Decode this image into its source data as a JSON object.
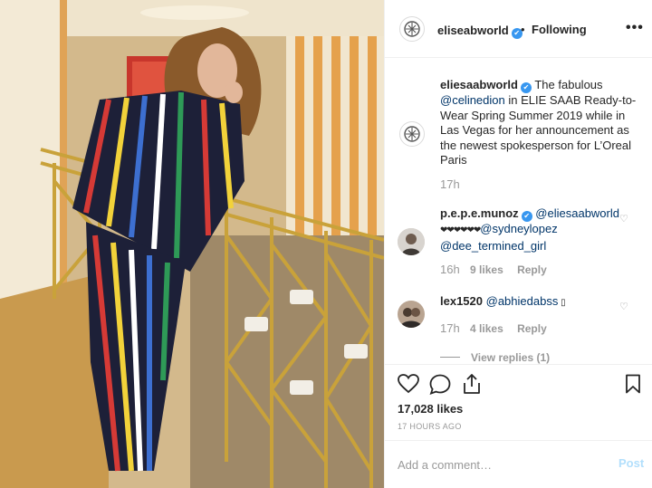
{
  "photo": {
    "description_icon": "fashion-photo"
  },
  "header": {
    "username": "eliseabworld",
    "separator": "•",
    "follow_status": "Following",
    "more_label": "•••"
  },
  "caption": {
    "username": "eliesaabworld",
    "text_1": " The fabulous ",
    "mention": "@celinedion",
    "text_2": " in ELIE SAAB Ready-to-Wear Spring Summer 2019 while in Las Vegas for her announcement as the newest spokesperson for L’Oreal Paris",
    "time": "17h"
  },
  "comments": [
    {
      "username": "p.e.p.e.munoz",
      "mention_1": "@eliesaabworld",
      "hearts": "❤❤❤❤❤❤",
      "mention_2": "@sydneylopez",
      "mention_3": "@dee_termined_girl",
      "time": "16h",
      "likes": "9 likes",
      "reply": "Reply"
    },
    {
      "username": "lex1520",
      "mention_1": "@abhiedabss",
      "tail": " ▯",
      "time": "17h",
      "likes": "4 likes",
      "reply": "Reply"
    }
  ],
  "view_replies": "View replies (1)",
  "actions": {
    "likes": "17,028 likes",
    "timestamp": "17 HOURS AGO"
  },
  "comment_box": {
    "placeholder": "Add a comment…",
    "post_label": "Post"
  },
  "colors": {
    "accent": "#3897f0",
    "link": "#003569",
    "muted": "#999999",
    "post_disabled": "#b2dffc"
  }
}
